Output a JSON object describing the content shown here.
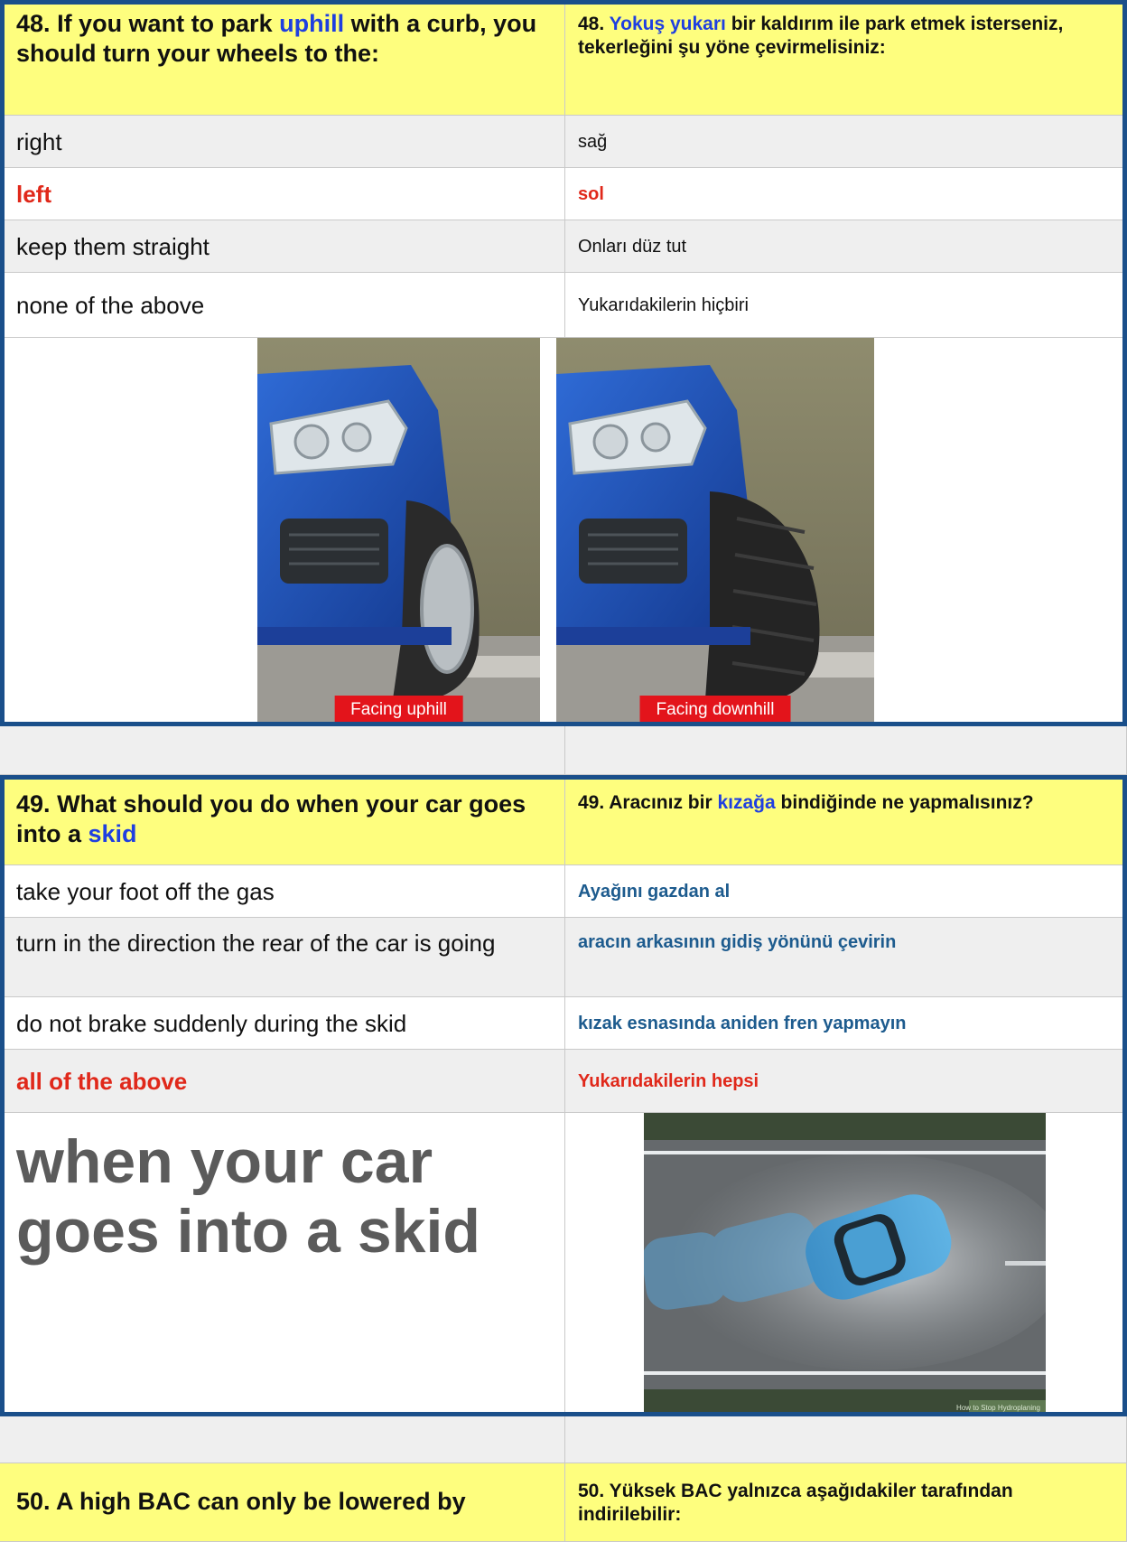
{
  "q48": {
    "number": "48.",
    "en_pre": "If you want to park",
    "en_hl": "uphill",
    "en_post": "with a curb, you should turn your wheels to the:",
    "tr_number": "48.",
    "tr_hl": "Yokuş yukarı",
    "tr_post": "bir kaldırım ile park etmek isterseniz, tekerleğini şu yöne çevirmelisiniz:",
    "answers": [
      {
        "en": "right",
        "tr": "sağ"
      },
      {
        "en": "left",
        "tr": "sol"
      },
      {
        "en": "keep them straight",
        "tr": "Onları düz tut"
      },
      {
        "en": "none of the above",
        "tr": "Yukarıdakilerin hiçbiri"
      }
    ],
    "photos": {
      "left_caption": "Facing uphill",
      "right_caption": "Facing downhill"
    }
  },
  "q49": {
    "number": "49.",
    "en_pre": "What should you do when your car goes into a",
    "en_hl": "skid",
    "tr_number": "49.",
    "tr_pre": "Aracınız bir",
    "tr_hl": "kızağa",
    "tr_post": "bindiğinde ne yapmalısınız?",
    "answers": [
      {
        "en": "take your foot off the gas",
        "tr": "Ayağını gazdan al"
      },
      {
        "en": "turn in the direction the rear of the car is going",
        "tr": "aracın arkasının gidiş yönünü çevirin"
      },
      {
        "en": "do not brake suddenly during the skid",
        "tr": "kızak esnasında aniden fren yapmayın"
      },
      {
        "en": "all of the above",
        "tr": "Yukarıdakilerin hepsi"
      }
    ],
    "big_text": "when your car goes into a skid",
    "watermark": "How to Stop Hydroplaning"
  },
  "q50": {
    "en": "50. A high BAC can only be lowered by",
    "tr": "50. Yüksek BAC yalnızca aşağıdakiler tarafından indirilebilir:"
  },
  "colors": {
    "header_yellow": "#fefe7e",
    "highlight_blue": "#1f3fe0",
    "correct_red": "#e0281a",
    "answer_teal": "#1d5b8e",
    "frame_blue": "#1a4f8a",
    "caption_red": "#e3141b"
  }
}
